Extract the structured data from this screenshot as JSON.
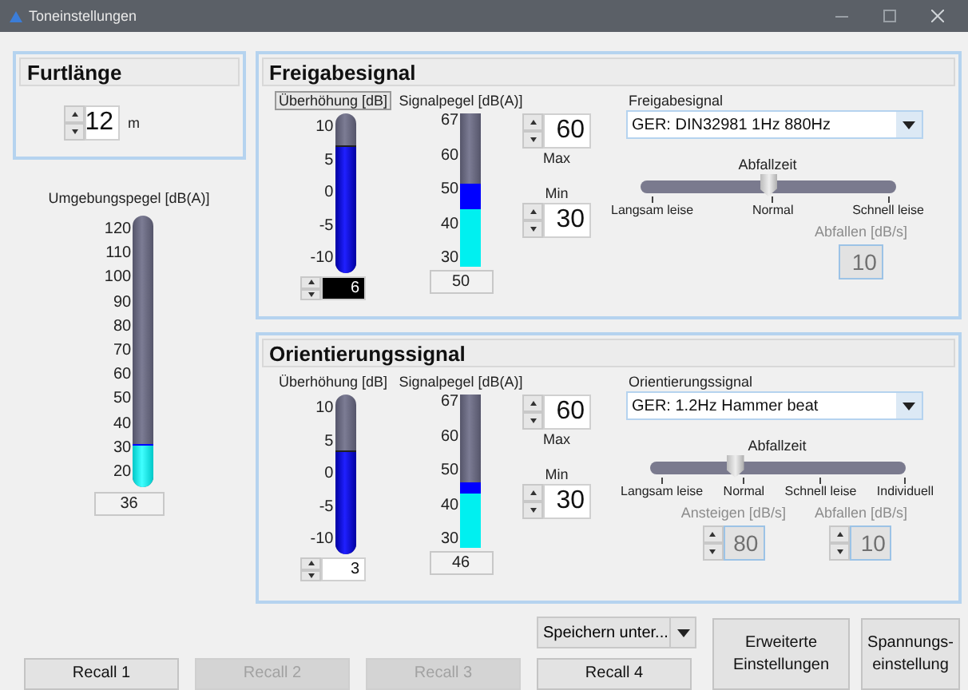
{
  "window": {
    "title": "Toneinstellungen"
  },
  "crossing_length": {
    "title": "Furtlänge",
    "value": "12",
    "unit": "m"
  },
  "ambient_level": {
    "label": "Umgebungspegel [dB(A)]",
    "ticks": [
      "120",
      "110",
      "100",
      "90",
      "80",
      "70",
      "60",
      "50",
      "40",
      "30",
      "20"
    ],
    "level": 0.16,
    "reading": "36"
  },
  "signals": [
    {
      "title": "Freigabesignal",
      "boost": {
        "label": "Überhöhung [dB]",
        "ticks": [
          "10",
          "5",
          "0",
          "-5",
          "-10"
        ],
        "level": 0.8,
        "value": "6",
        "selected": true
      },
      "signal_level": {
        "label": "Signalpegel [dB(A)]",
        "ticks": [
          "67",
          "60",
          "50",
          "40",
          "30"
        ],
        "level": 0.54,
        "base": {
          "level": 0.37
        },
        "reading": "50"
      },
      "max": {
        "value": "60",
        "label": "Max"
      },
      "min": {
        "label": "Min",
        "value": "30"
      },
      "tone": {
        "label": "Freigabesignal",
        "value": "GER: DIN32981 1Hz 880Hz"
      },
      "decay": {
        "title": "Abfallzeit",
        "stops": [
          "Langsam leise",
          "Normal",
          "Schnell leise"
        ],
        "level": 0.5
      },
      "rates": [
        {
          "label": "Abfallen [dB/s]",
          "value": "10",
          "kind": "plain",
          "disabled": true
        }
      ]
    },
    {
      "title": "Orientierungssignal",
      "boost": {
        "label": "Überhöhung [dB]",
        "ticks": [
          "10",
          "5",
          "0",
          "-5",
          "-10"
        ],
        "level": 0.65,
        "value": "3",
        "selected": false
      },
      "signal_level": {
        "label": "Signalpegel [dB(A)]",
        "ticks": [
          "67",
          "60",
          "50",
          "40",
          "30"
        ],
        "level": 0.43,
        "base": {
          "level": 0.35
        },
        "reading": "46"
      },
      "max": {
        "value": "60",
        "label": "Max"
      },
      "min": {
        "label": "Min",
        "value": "30"
      },
      "tone": {
        "label": "Orientierungssignal",
        "value": "GER: 1.2Hz Hammer beat"
      },
      "decay": {
        "title": "Abfallzeit",
        "stops": [
          "Langsam leise",
          "Normal",
          "Schnell leise",
          "Individuell"
        ],
        "level": 0.333
      },
      "rates": [
        {
          "label": "Ansteigen [dB/s]",
          "value": "80",
          "kind": "spin",
          "disabled": true
        },
        {
          "label": "Abfallen [dB/s]",
          "value": "10",
          "kind": "spin",
          "disabled": true
        }
      ]
    }
  ],
  "save_menu": {
    "label": "Speichern unter..."
  },
  "recalls": [
    {
      "label": "Recall 1",
      "disabled": false
    },
    {
      "label": "Recall 2",
      "disabled": true
    },
    {
      "label": "Recall 3",
      "disabled": true
    },
    {
      "label": "Recall 4",
      "disabled": false
    }
  ],
  "actions": [
    {
      "lines": [
        "Erweiterte",
        "Einstellungen"
      ]
    },
    {
      "lines": [
        "Spannungs-",
        "einstellung"
      ]
    }
  ]
}
